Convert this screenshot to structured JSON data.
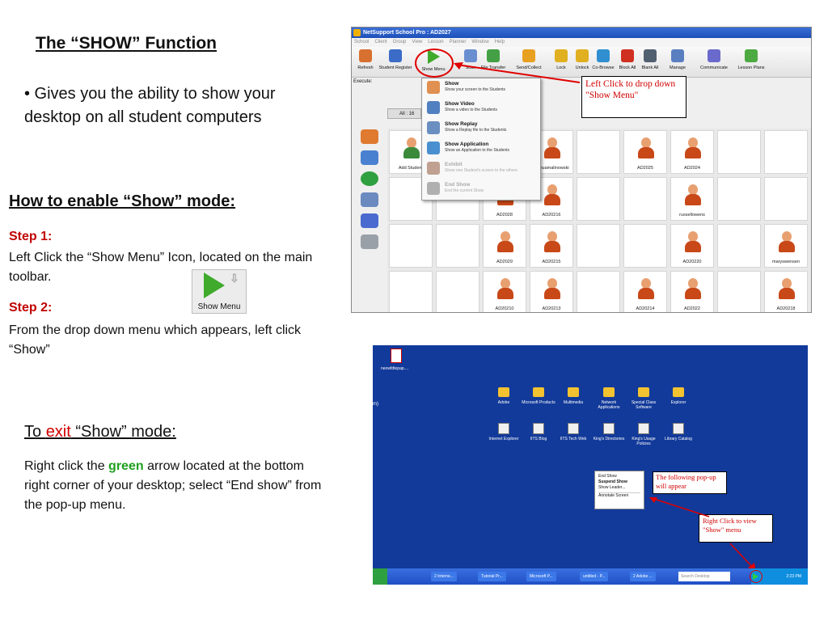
{
  "slide": {
    "title": "The “SHOW” Function",
    "bullet": "• Gives you the ability to show your desktop on all student computers",
    "enable_heading": "How to enable “Show” mode:",
    "step1_label": "Step 1:",
    "step1_text": "Left Click the “Show Menu” Icon, located on the main toolbar.",
    "step2_label": "Step 2:",
    "step2_text": "From the drop down menu which appears, left click “Show”",
    "show_menu_button_label": "Show Menu",
    "exit_heading_pre": "To ",
    "exit_heading_red": "exit",
    "exit_heading_post": " “Show” mode:",
    "exit_text_pre": "Right click the ",
    "exit_text_green": "green",
    "exit_text_post": " arrow located at the bottom right corner of your desktop; select “End show” from the pop-up menu."
  },
  "netsupport": {
    "window_title": "NetSupport School Pro : AD2027",
    "menu": [
      "School",
      "Client",
      "Group",
      "View",
      "Lesson",
      "Planner",
      "Window",
      "Help"
    ],
    "toolbar": [
      {
        "label": "Refresh",
        "icon": "refresh-icon",
        "color": "#d87030"
      },
      {
        "label": "Student Register",
        "icon": "register-icon",
        "color": "#3a6cc8"
      },
      {
        "label": "Show Menu",
        "icon": "show-play-icon",
        "color": "#3faa2c"
      },
      {
        "label": "Scan",
        "icon": "scan-icon",
        "color": "#6a8fd0"
      },
      {
        "label": "File Transfer",
        "icon": "file-transfer-icon",
        "color": "#44a044"
      },
      {
        "label": "Send/Collect",
        "icon": "send-collect-icon",
        "color": "#e8a020"
      },
      {
        "label": "Lock",
        "icon": "lock-icon",
        "color": "#e0b020"
      },
      {
        "label": "Unlock",
        "icon": "unlock-icon",
        "color": "#e0b020"
      },
      {
        "label": "Co-Browse",
        "icon": "globe-icon",
        "color": "#2f8fd0"
      },
      {
        "label": "Block All",
        "icon": "block-icon",
        "color": "#d03020"
      },
      {
        "label": "Blank All",
        "icon": "monitor-icon",
        "color": "#506070"
      },
      {
        "label": "Manage",
        "icon": "manage-icon",
        "color": "#5a7fc0"
      },
      {
        "label": "Communicate",
        "icon": "communicate-icon",
        "color": "#6a6acc"
      },
      {
        "label": "Lesson Plans",
        "icon": "lesson-plans-icon",
        "color": "#4caa40"
      }
    ],
    "execute_label": "Execute:",
    "all_tab": "All : 16",
    "add_student": "Add Student",
    "callout": "Left Click to drop down \"Show Menu\"",
    "dropdown": [
      {
        "title": "Show",
        "desc": "Show your screen to the Students",
        "icon": "show-icon",
        "color": "#e09050",
        "disabled": false
      },
      {
        "title": "Show Video",
        "desc": "Show a video to the Students",
        "icon": "video-icon",
        "color": "#5080c0",
        "disabled": false
      },
      {
        "title": "Show Replay",
        "desc": "Show a Replay file to the Students",
        "icon": "replay-icon",
        "color": "#6a8fc0",
        "disabled": false
      },
      {
        "title": "Show Application",
        "desc": "Show an Application to the Students",
        "icon": "application-icon",
        "color": "#4a90d0",
        "disabled": false
      },
      {
        "title": "Exhibit",
        "desc": "Show one Student's screen to the others",
        "icon": "exhibit-icon",
        "color": "#c0a090",
        "disabled": true
      },
      {
        "title": "End Show",
        "desc": "End the current Show",
        "icon": "end-show-icon",
        "color": "#b0b0b0",
        "disabled": true
      }
    ],
    "students": [
      {
        "name": "joshuamalinowski",
        "r": 0,
        "c": 3
      },
      {
        "name": "AD2025",
        "r": 0,
        "c": 5
      },
      {
        "name": "AD2024",
        "r": 0,
        "c": 6
      },
      {
        "name": "AD2028",
        "r": 1,
        "c": 2
      },
      {
        "name": "AD20216",
        "r": 1,
        "c": 3
      },
      {
        "name": "russellowens",
        "r": 1,
        "c": 6
      },
      {
        "name": "AD2029",
        "r": 2,
        "c": 2
      },
      {
        "name": "AD20215",
        "r": 2,
        "c": 3
      },
      {
        "name": "AD20220",
        "r": 2,
        "c": 6
      },
      {
        "name": "maryswensen",
        "r": 2,
        "c": 8
      },
      {
        "name": "AD20210",
        "r": 3,
        "c": 2
      },
      {
        "name": "AD20213",
        "r": 3,
        "c": 3
      },
      {
        "name": "AD20214",
        "r": 3,
        "c": 5
      },
      {
        "name": "AD2022",
        "r": 3,
        "c": 6
      },
      {
        "name": "AD20218",
        "r": 3,
        "c": 8
      }
    ]
  },
  "desktop": {
    "top_file": "neowfdtepap....",
    "left_cut": "m)",
    "icons_row1": [
      {
        "label": "Adobe",
        "type": "folder"
      },
      {
        "label": "Microsoft Products",
        "type": "folder"
      },
      {
        "label": "Multimedia",
        "type": "folder"
      },
      {
        "label": "Network Applications",
        "type": "folder"
      },
      {
        "label": "Special Class Software",
        "type": "folder"
      },
      {
        "label": "Explorer",
        "type": "folder"
      }
    ],
    "icons_row2": [
      {
        "label": "Internet Explorer",
        "type": "page"
      },
      {
        "label": "IITS Blog",
        "type": "page"
      },
      {
        "label": "IITS Tech Web",
        "type": "page"
      },
      {
        "label": "King's Directories",
        "type": "page"
      },
      {
        "label": "King's Usage Policies",
        "type": "page"
      },
      {
        "label": "Library Catalog",
        "type": "page"
      }
    ],
    "popup": [
      "End Show",
      "Suspend Show",
      "Show Leader...",
      "Annotate Screen"
    ],
    "callout1": "The following pop-up will appear",
    "callout2": "Right Click to view \"Show\" menu",
    "taskbar": [
      "2 Interne...",
      "Tutorial Pr...",
      "Microsoft P...",
      "untitled - P...",
      "2 Adobe ..."
    ],
    "search": "Search Desktop",
    "clock": "2:23 PM"
  }
}
